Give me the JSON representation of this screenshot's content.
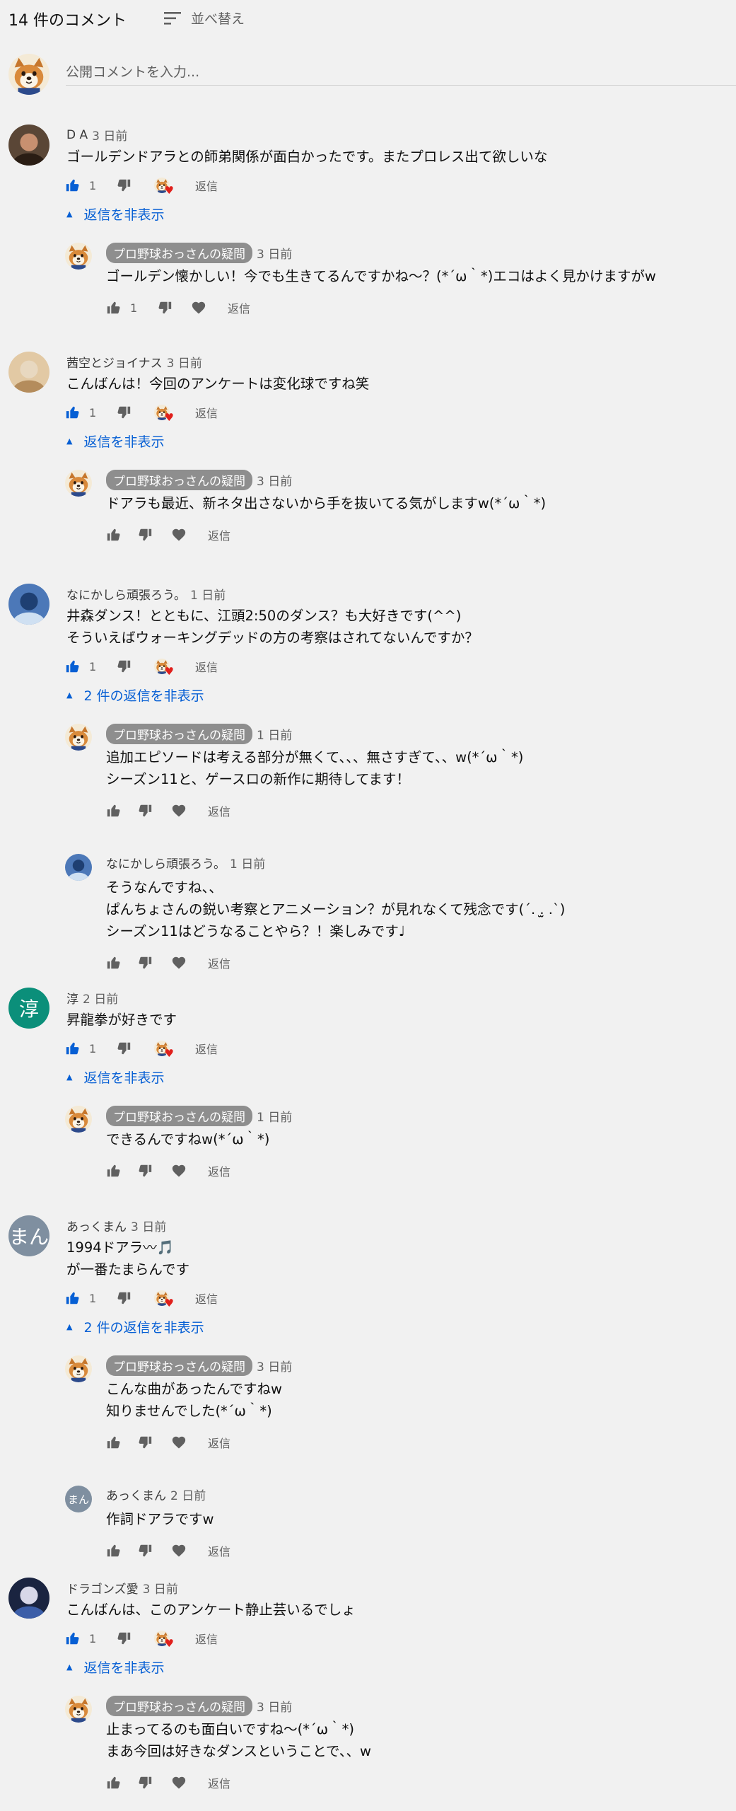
{
  "header": {
    "comment_count": "14 件のコメント",
    "sort_label": "並べ替え",
    "sort_icon": "sort-icon"
  },
  "comment_input": {
    "placeholder": "公開コメントを入力..."
  },
  "actions": {
    "reply_label": "返信",
    "like_icon": "thumb-up-icon",
    "dislike_icon": "thumb-down-icon",
    "heart_icon": "creator-heart-icon"
  },
  "colors": {
    "background": "#f1f1f1",
    "link_blue": "#065fd4",
    "like_blue": "#065fd4",
    "heart_red": "#e0201c",
    "badge_gray": "#8e8e8e",
    "avatar_teal": "#0b8f7a",
    "avatar_slate": "#7f8fa0"
  },
  "threads": [
    {
      "author": "D A",
      "time": "3 日前",
      "text": "ゴールデンドアラとの師弟関係が面白かったです。またプロレス出て欲しいな",
      "likes": "1",
      "toggle": "返信を非表示",
      "replies": [
        {
          "author": "プロ野球おっさんの疑問",
          "time": "3 日前",
          "text": "ゴールデン懐かしい！今でも生きてるんですかね〜？(*´ω｀*)エコはよく見かけますがw",
          "likes": "1"
        }
      ]
    },
    {
      "author": "茜空とジョイナス",
      "time": "3 日前",
      "text": "こんばんは！今回のアンケートは変化球ですね笑",
      "likes": "1",
      "toggle": "返信を非表示",
      "replies": [
        {
          "author": "プロ野球おっさんの疑問",
          "time": "3 日前",
          "text": "ドアラも最近、新ネタ出さないから手を抜いてる気がしますw(*´ω｀*)",
          "likes": ""
        }
      ]
    },
    {
      "author": "なにかしら頑張ろう。",
      "time": "1 日前",
      "text": "井森ダンス！とともに、江頭2:50のダンス？も大好きです(^^)\nそういえばウォーキングデッドの方の考察はされてないんですか？",
      "likes": "1",
      "toggle": "2 件の返信を非表示",
      "replies": [
        {
          "author": "プロ野球おっさんの疑問",
          "time": "1 日前",
          "text": "追加エピソードは考える部分が無くて、、、無さすぎて、、w(*´ω｀*)\nシーズン11と、ゲースロの新作に期待してます！",
          "likes": ""
        },
        {
          "author": "なにかしら頑張ろう。",
          "time": "1 日前",
          "text": "そうなんですね、、\nぱんちょさんの鋭い考察とアニメーション？が見れなくて残念です(´. .̫ .`)\nシーズン11はどうなることやら？！楽しみです♩",
          "likes": ""
        }
      ]
    },
    {
      "author": "淳",
      "avatar_letter": "淳",
      "time": "2 日前",
      "text": "昇龍拳が好きです",
      "likes": "1",
      "toggle": "返信を非表示",
      "replies": [
        {
          "author": "プロ野球おっさんの疑問",
          "time": "1 日前",
          "text": "できるんですねw(*´ω｀*)",
          "likes": ""
        }
      ]
    },
    {
      "author": "あっくまん",
      "avatar_letter": "まん",
      "time": "3 日前",
      "text": "1994ドアラ〰🎵\nが一番たまらんです",
      "likes": "1",
      "toggle": "2 件の返信を非表示",
      "replies": [
        {
          "author": "プロ野球おっさんの疑問",
          "time": "3 日前",
          "text": "こんな曲があったんですねw\n知りませんでした(*´ω｀*)",
          "likes": ""
        },
        {
          "author": "あっくまん",
          "avatar_letter": "まん",
          "time": "2 日前",
          "text": "作詞ドアラですw",
          "likes": ""
        }
      ]
    },
    {
      "author": "ドラゴンズ愛",
      "time": "3 日前",
      "text": "こんばんは、このアンケート静止芸いるでしょ",
      "likes": "1",
      "toggle": "返信を非表示",
      "replies": [
        {
          "author": "プロ野球おっさんの疑問",
          "time": "3 日前",
          "text": "止まってるのも面白いですね〜(*´ω｀*)\nまあ今回は好きなダンスということで、、w",
          "likes": ""
        }
      ]
    }
  ]
}
